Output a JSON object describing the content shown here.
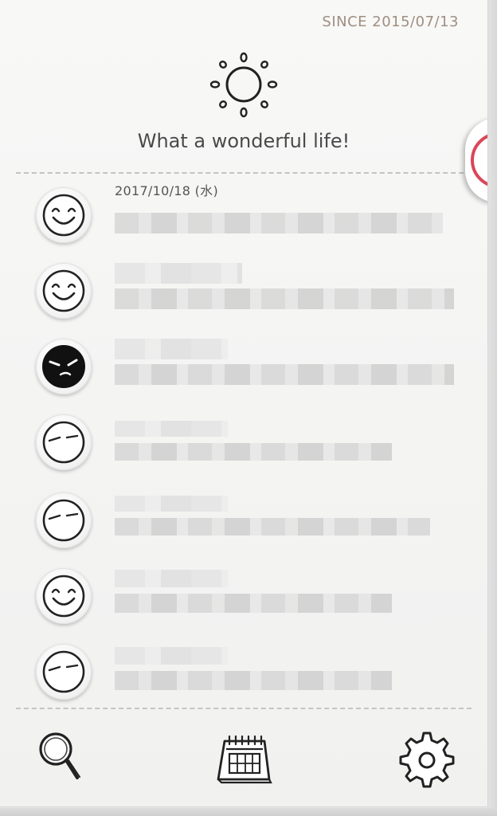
{
  "header": {
    "since": "SINCE 2015/07/13",
    "title": "What a wonderful life!",
    "weather_icon": "sun-icon"
  },
  "entries": [
    {
      "mood": "happy",
      "date": "2017/10/18 (水)"
    },
    {
      "mood": "happy"
    },
    {
      "mood": "angry"
    },
    {
      "mood": "calm"
    },
    {
      "mood": "calm"
    },
    {
      "mood": "happy"
    },
    {
      "mood": "calm"
    }
  ],
  "toolbar": {
    "search_icon": "magnifier-icon",
    "calendar_icon": "calendar-icon",
    "settings_icon": "gear-icon"
  },
  "colors": {
    "since_text": "#a08e80",
    "accent_ring": "#d9475a"
  }
}
